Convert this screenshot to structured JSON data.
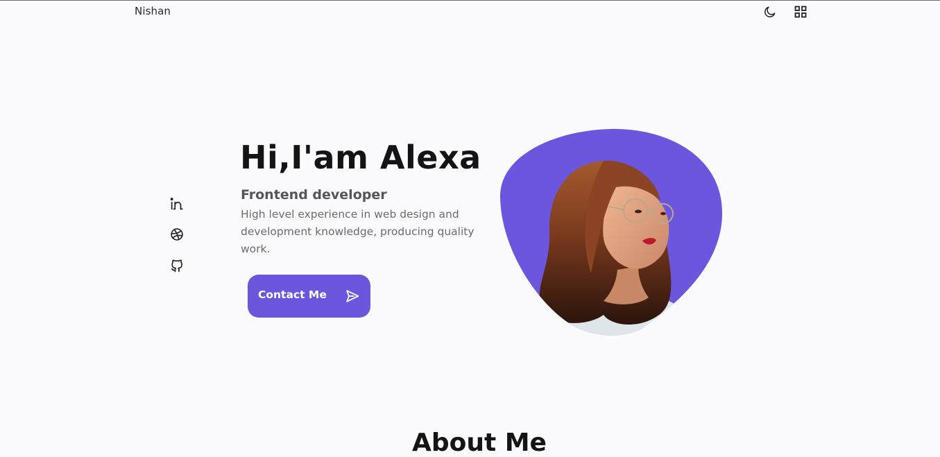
{
  "header": {
    "logo": "Nishan",
    "theme_toggle_icon": "moon-icon",
    "menu_icon": "grid-icon"
  },
  "social": [
    {
      "name": "linkedin",
      "icon": "linkedin-icon"
    },
    {
      "name": "dribbble",
      "icon": "dribbble-icon"
    },
    {
      "name": "github",
      "icon": "github-icon"
    }
  ],
  "hero": {
    "title": "Hi,I'am Alexa",
    "subtitle": "Frontend developer",
    "description": "High level experience in web design and development knowledge, producing quality work.",
    "cta_label": "Contact Me",
    "cta_icon": "send-icon"
  },
  "colors": {
    "accent": "#6c56dd",
    "background": "#fafaff",
    "title": "#141414",
    "text": "#6b6b6b"
  },
  "next_section": {
    "title": "About Me"
  }
}
